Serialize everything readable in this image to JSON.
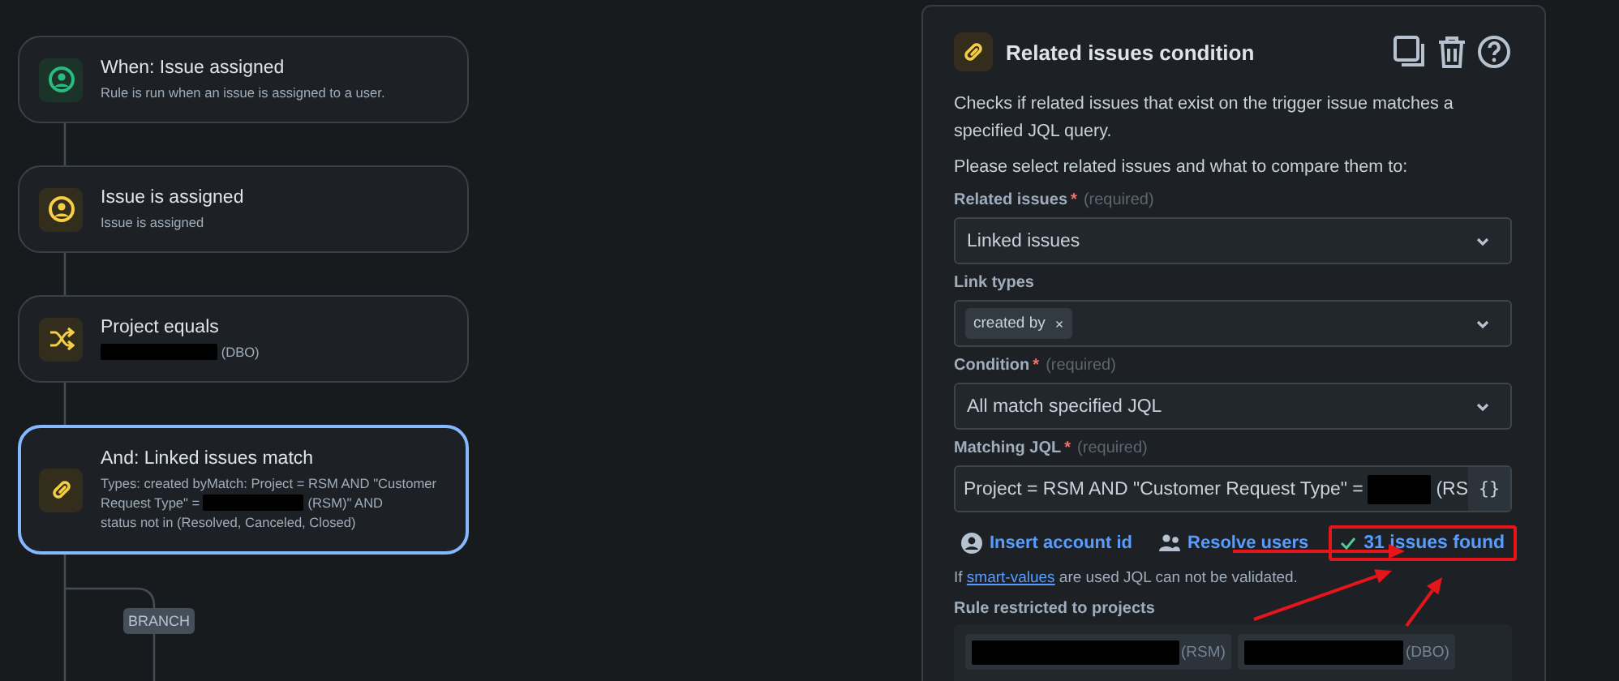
{
  "canvas": {
    "cards": [
      {
        "kind": "trigger",
        "selected": false,
        "title": "When: Issue assigned",
        "description": [
          {
            "text": "Rule is run when an issue is assigned to a user."
          }
        ]
      },
      {
        "kind": "user-condition",
        "selected": false,
        "title": "Issue is assigned",
        "description": [
          {
            "text": "Issue is assigned"
          }
        ]
      },
      {
        "kind": "project-condition",
        "selected": false,
        "title": "Project equals",
        "description": [
          {
            "redacted": true
          },
          {
            "text": "(DBO)"
          }
        ]
      },
      {
        "kind": "link-condition",
        "selected": true,
        "title": "And: Linked issues match",
        "description": [
          {
            "text": "Types: created byMatch: Project = RSM AND \"Customer"
          },
          {
            "text": "Request Type\" ="
          },
          {
            "redacted": true
          },
          {
            "text": "(RSM)\" AND"
          },
          {
            "text": "status not in (Resolved, Canceled, Closed)"
          }
        ]
      }
    ],
    "branch_label": "BRANCH"
  },
  "panel": {
    "title": "Related issues condition",
    "description": "Checks if related issues that exist on the trigger issue matches a specified JQL query.",
    "prompt": "Please select related issues and what to compare them to:",
    "fields": [
      {
        "kind": "select",
        "label": "Related issues",
        "required_mark": "*",
        "required_note": "(required)",
        "value": "Linked issues"
      },
      {
        "kind": "tags",
        "label": "Link types",
        "tags": [
          "created by"
        ],
        "tag_remove": "×"
      },
      {
        "kind": "select",
        "label": "Condition",
        "required_mark": "*",
        "required_note": "(required)",
        "value": "All match specified JQL"
      },
      {
        "kind": "jql",
        "label": "Matching JQL",
        "required_mark": "*",
        "required_note": "(required)",
        "value": [
          {
            "text": "Project = RSM AND \"Customer Request Type\" = "
          },
          {
            "redacted": true
          },
          {
            "text": "(RS"
          }
        ],
        "button": "{}"
      }
    ],
    "links": [
      "Insert account id",
      "Resolve users"
    ],
    "validation": {
      "text": "31 issues found",
      "valid": true,
      "highlighted": true
    },
    "note": {
      "before": "If ",
      "link": "smart-values",
      "after": " are used JQL can not be validated."
    },
    "projects": {
      "label": "Rule restricted to projects",
      "items": [
        {
          "redacted": true,
          "key": "(RSM)"
        },
        {
          "redacted": true,
          "key": "(DBO)"
        }
      ]
    }
  },
  "annotations": [
    {
      "kind": "arrow"
    },
    {
      "kind": "arrow"
    },
    {
      "kind": "arrow"
    }
  ]
}
